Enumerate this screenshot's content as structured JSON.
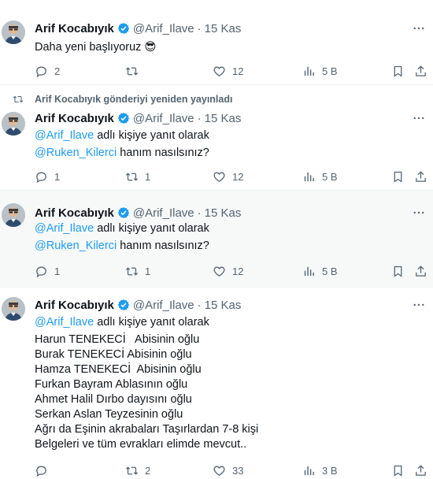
{
  "tweets": [
    {
      "name": "Arif Kocabıyık",
      "handle": "@Arif_Ilave",
      "date": "15 Kas",
      "lines": [
        "Daha yeni başlıyoruz 😎"
      ],
      "replies": "2",
      "retweets": "",
      "likes": "12",
      "views": "5 B"
    },
    {
      "retweet_banner": "Arif Kocabıyık gönderiyi yeniden yayınladı",
      "name": "Arif Kocabıyık",
      "handle": "@Arif_Ilave",
      "date": "15 Kas",
      "reply_mention": "@Arif_Ilave",
      "reply_suffix": " adlı kişiye yanıt olarak",
      "mention2": "@Ruken_Kilerci",
      "mention2_suffix": " hanım nasılsınız?",
      "replies": "1",
      "retweets": "1",
      "likes": "12",
      "views": "5 B"
    },
    {
      "name": "Arif Kocabıyık",
      "handle": "@Arif_Ilave",
      "date": "15 Kas",
      "reply_mention": "@Arif_Ilave",
      "reply_suffix": " adlı kişiye yanıt olarak",
      "mention2": "@Ruken_Kilerci",
      "mention2_suffix": " hanım nasılsınız?",
      "replies": "1",
      "retweets": "1",
      "likes": "12",
      "views": "5 B"
    },
    {
      "name": "Arif Kocabıyık",
      "handle": "@Arif_Ilave",
      "date": "15 Kas",
      "reply_mention": "@Arif_Ilave",
      "reply_suffix": " adlı kişiye yanıt olarak",
      "lines": [
        "Harun TENEKECİ   Abisinin oğlu",
        "Burak TENEKECİ Abisinin oğlu",
        "Hamza TENEKECİ  Abisinin oğlu",
        "Furkan Bayram Ablasının oğlu",
        "Ahmet Halil Dırbo dayısını oğlu",
        "Serkan Aslan Teyzesinin oğlu",
        "Ağrı da Eşinin akrabaları Taşırlardan 7-8 kişi",
        "Belgeleri ve tüm evrakları elimde mevcut.."
      ],
      "replies": "",
      "retweets": "2",
      "likes": "33",
      "views": "3 B"
    }
  ],
  "colors": {
    "accent": "#1d9bf0",
    "muted": "#536471",
    "text": "#0f1419",
    "shaded_bg": "#f7f9f9"
  },
  "icons": [
    "reply-icon",
    "retweet-icon",
    "like-icon",
    "views-icon",
    "bookmark-icon",
    "share-icon",
    "more-icon",
    "verified-badge-icon"
  ]
}
